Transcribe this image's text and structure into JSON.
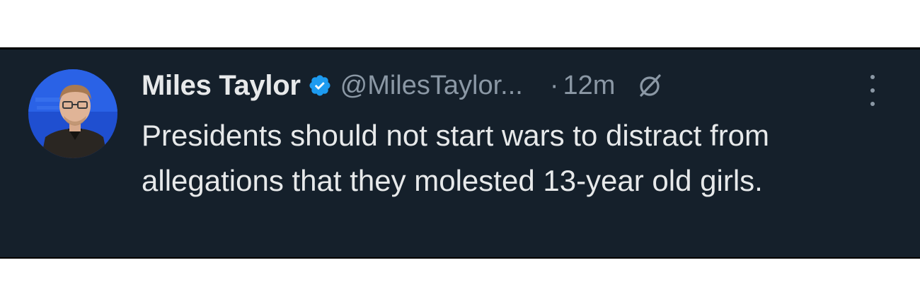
{
  "tweet": {
    "author_name": "Miles Taylor",
    "handle": "@MilesTaylor...",
    "separator": "·",
    "time": "12m",
    "text": "Presidents should not start wars to distract from allegations that they molested 13-year old girls."
  },
  "icons": {
    "verified": "verified-badge-icon",
    "grok": "grok-icon",
    "more": "more-options-icon"
  },
  "colors": {
    "background": "#15202b",
    "text_primary": "#e7e9ea",
    "text_secondary": "#8b98a5",
    "verified_blue": "#1d9bf0"
  }
}
